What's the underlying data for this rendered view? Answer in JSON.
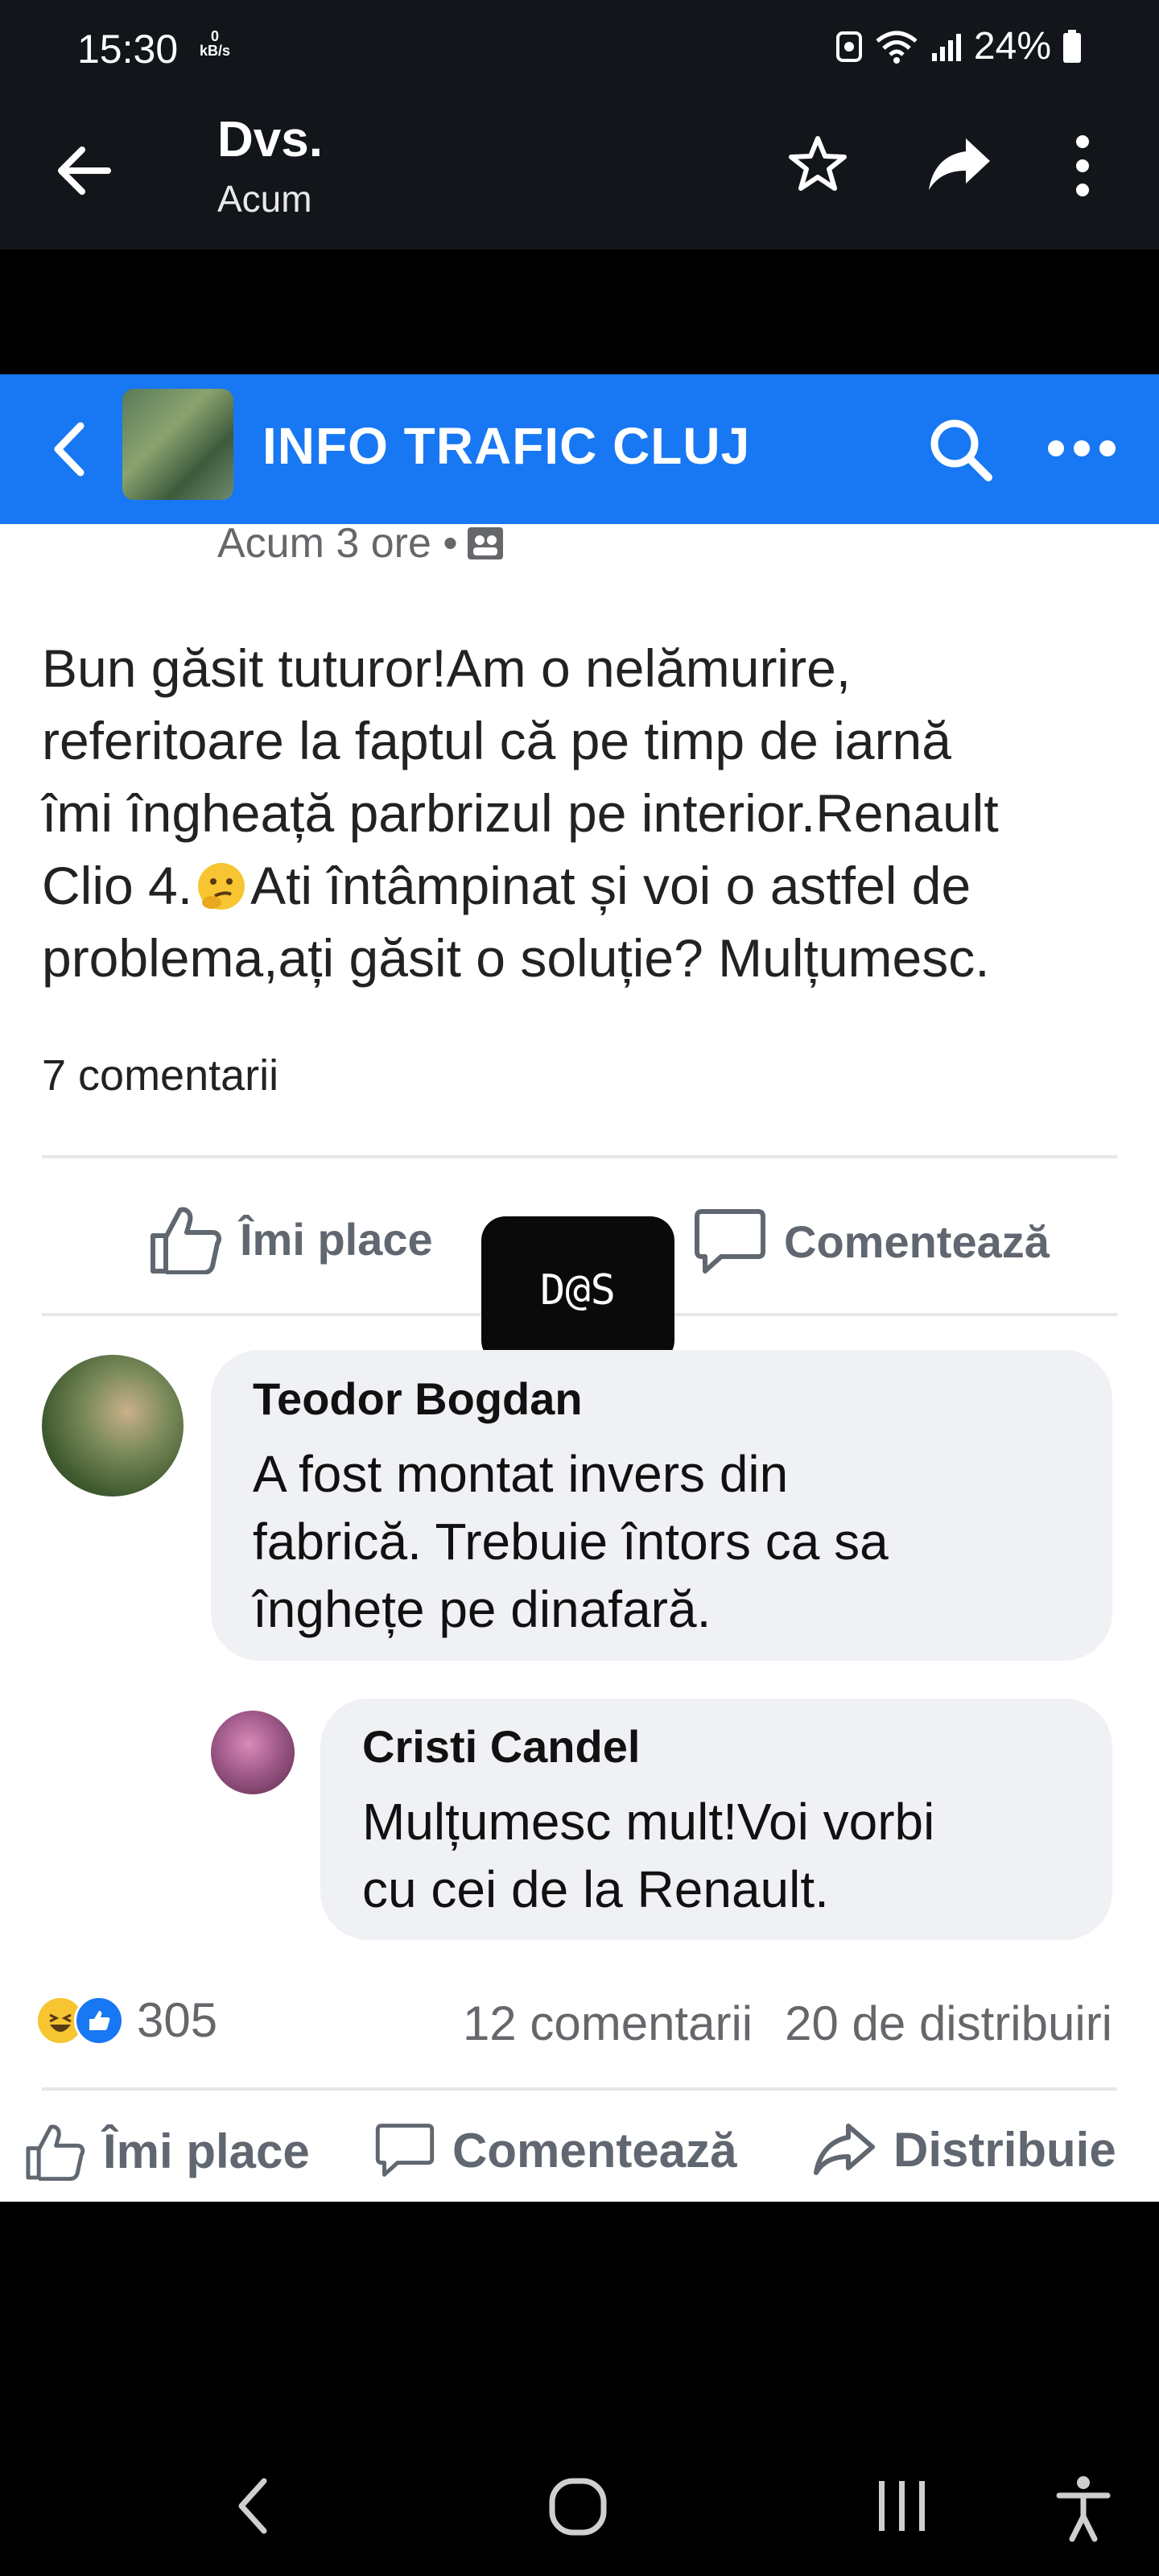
{
  "status_bar": {
    "time": "15:30",
    "net_speed_value": "0",
    "net_speed_unit": "kB/s",
    "battery": "24%"
  },
  "viewer": {
    "title": "Dvs.",
    "subtitle": "Acum",
    "icons": [
      "back-arrow-icon",
      "star-icon",
      "share-icon",
      "more-vertical-icon"
    ]
  },
  "fb": {
    "group_name": "INFO TRAFIC CLUJ",
    "post_time": "Acum 3 ore •",
    "post_lines": [
      "Bun găsit tuturor!Am o nelămurire,",
      "referitoare la faptul că pe timp de iarnă",
      "îmi îngheață parbrizul pe interior.Renault",
      "Clio 4.",
      "Ati întâmpinat și voi o astfel de",
      "problema,ați găsit o soluție? Mulțumesc."
    ],
    "comment_count": "7 comentarii",
    "inner_actions": {
      "like": "Îmi place",
      "comment": "Comentează"
    },
    "watermark": "D@S",
    "comments": [
      {
        "author": "Teodor Bogdan",
        "lines": [
          "A fost montat invers din",
          "fabrică. Trebuie întors ca sa",
          "înghețe pe dinafară."
        ]
      },
      {
        "author": "Cristi Candel",
        "lines": [
          "Mulțumesc mult!Voi vorbi",
          "cu cei de la Renault."
        ]
      }
    ],
    "reaction_count": "305",
    "comments_total": "12 comentarii",
    "shares_total": "20 de distribuiri",
    "bottom_actions": {
      "like": "Îmi place",
      "comment": "Comentează",
      "share": "Distribuie"
    }
  },
  "colors": {
    "facebook_blue": "#1877f2",
    "status_bar_bg": "#12151a"
  }
}
